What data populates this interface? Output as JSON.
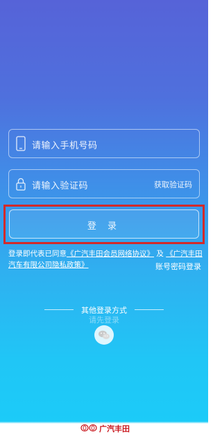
{
  "login": {
    "phone_placeholder": "请输入手机号码",
    "code_placeholder": "请输入验证码",
    "get_code": "获取验证码",
    "login_button": "登 录"
  },
  "agreement": {
    "prefix": "登录即代表已同意",
    "link1": "《广汽丰田会员网络协议》",
    "conjunction": "及",
    "link2": "《广汽丰田汽车有限公司隐私政策》"
  },
  "account_login": "账号密码登录",
  "other_login": {
    "title": "其他登录方式",
    "toast": "请先登录"
  },
  "brand": {
    "name": "广汽丰田",
    "color": "#c8161d"
  },
  "colors": {
    "highlight": "#d32a2a",
    "gradient_top": "#5663d8",
    "gradient_bottom": "#1ccbf8"
  },
  "icons": [
    "phone-icon",
    "lock-icon",
    "wechat-icon",
    "toyota-logo-icon"
  ]
}
